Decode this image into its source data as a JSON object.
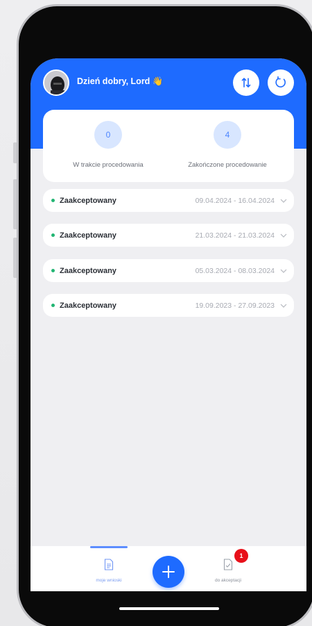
{
  "header": {
    "greeting": "Dzień dobry, Lord 👋",
    "brand_color": "#1e6bff"
  },
  "stats": [
    {
      "value": "0",
      "label": "W trakcie procedowania"
    },
    {
      "value": "4",
      "label": "Zakończone procedowanie"
    }
  ],
  "requests": [
    {
      "status": "Zaakceptowany",
      "dates": "09.04.2024 - 16.04.2024"
    },
    {
      "status": "Zaakceptowany",
      "dates": "21.03.2024 - 21.03.2024"
    },
    {
      "status": "Zaakceptowany",
      "dates": "05.03.2024 - 08.03.2024"
    },
    {
      "status": "Zaakceptowany",
      "dates": "19.09.2023 - 27.09.2023"
    }
  ],
  "bottom_nav": {
    "my_requests_label": "moje wnioski",
    "to_accept_label": "do akceptacji",
    "to_accept_badge": "1"
  },
  "icons": {
    "sort": "sort-icon",
    "refresh": "refresh-icon",
    "add": "plus-icon",
    "document": "document-icon",
    "approve": "document-check-icon"
  }
}
